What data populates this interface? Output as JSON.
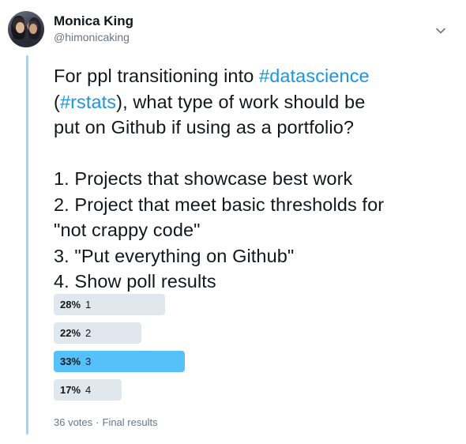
{
  "author": {
    "name": "Monica King",
    "handle": "@himonicaking"
  },
  "tweet": {
    "line1_pre": "For ppl transitioning into ",
    "line1_hashtag": "#datascience",
    "line2_open": "(",
    "line2_hashtag": "#rstats",
    "line2_post": "), what type of work should be",
    "line3": "put on Github if using as a portfolio?",
    "option_lines": [
      "1. Projects that showcase best work",
      "2. Project that meet basic thresholds for",
      "\"not crappy code\"",
      "3. \"Put everything on Github\"",
      "4.  Show poll results"
    ]
  },
  "poll": {
    "options": [
      {
        "percent_label": "28%",
        "label": "1",
        "percent": 28,
        "winner": false
      },
      {
        "percent_label": "22%",
        "label": "2",
        "percent": 22,
        "winner": false
      },
      {
        "percent_label": "33%",
        "label": "3",
        "percent": 33,
        "winner": true
      },
      {
        "percent_label": "17%",
        "label": "4",
        "percent": 17,
        "winner": false
      }
    ],
    "votes": "36 votes",
    "separator": "·",
    "status": "Final results"
  },
  "colors": {
    "hashtag": "#1b95e0",
    "bar": "#e1e8ed",
    "bar_winner": "#55c1f8",
    "thread_line": "#9fd5f8"
  },
  "icons": {
    "menu": "chevron-down-icon"
  }
}
